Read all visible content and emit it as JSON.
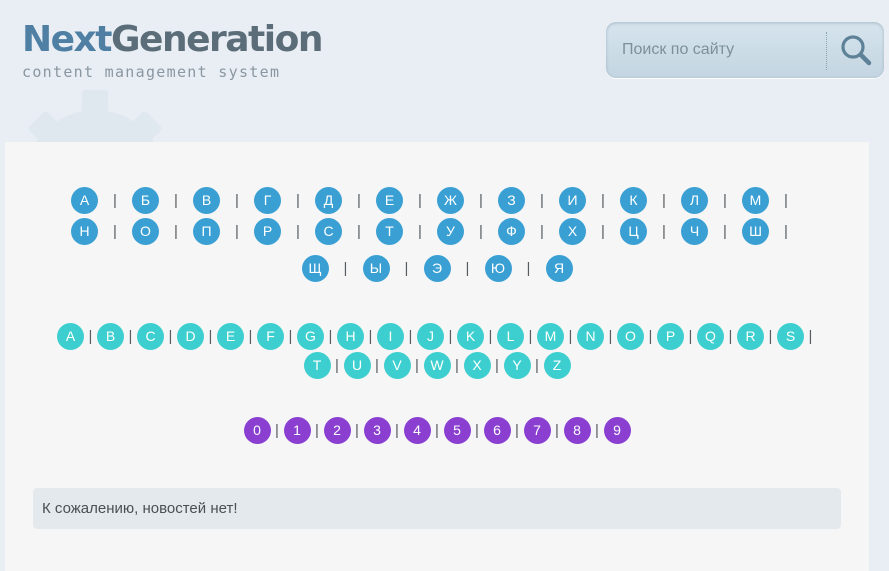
{
  "logo": {
    "title_part1": "Next",
    "title_part2": "Generation",
    "subtitle": "content management system"
  },
  "search": {
    "placeholder": "Поиск по сайту",
    "button_icon": "magnifier-icon"
  },
  "alphabet": {
    "russian": [
      [
        "А",
        "Б",
        "В",
        "Г",
        "Д",
        "Е",
        "Ж",
        "З",
        "И",
        "К",
        "Л",
        "М"
      ],
      [
        "Н",
        "О",
        "П",
        "Р",
        "С",
        "Т",
        "У",
        "Ф",
        "Х",
        "Ц",
        "Ч",
        "Ш"
      ],
      [
        "Щ",
        "Ы",
        "Э",
        "Ю",
        "Я"
      ]
    ],
    "latin": [
      [
        "A",
        "B",
        "C",
        "D",
        "E",
        "F",
        "G",
        "H",
        "I",
        "J",
        "K",
        "L",
        "M",
        "N",
        "O",
        "P",
        "Q",
        "R",
        "S"
      ],
      [
        "T",
        "U",
        "V",
        "W",
        "X",
        "Y",
        "Z"
      ]
    ],
    "digits": [
      [
        "0",
        "1",
        "2",
        "3",
        "4",
        "5",
        "6",
        "7",
        "8",
        "9"
      ]
    ],
    "separator": "|"
  },
  "colors": {
    "russian": "#3aa0d4",
    "latin": "#3dcfcf",
    "digits": "#8a3fd0"
  },
  "notice": "К сожалению, новостей нет!"
}
